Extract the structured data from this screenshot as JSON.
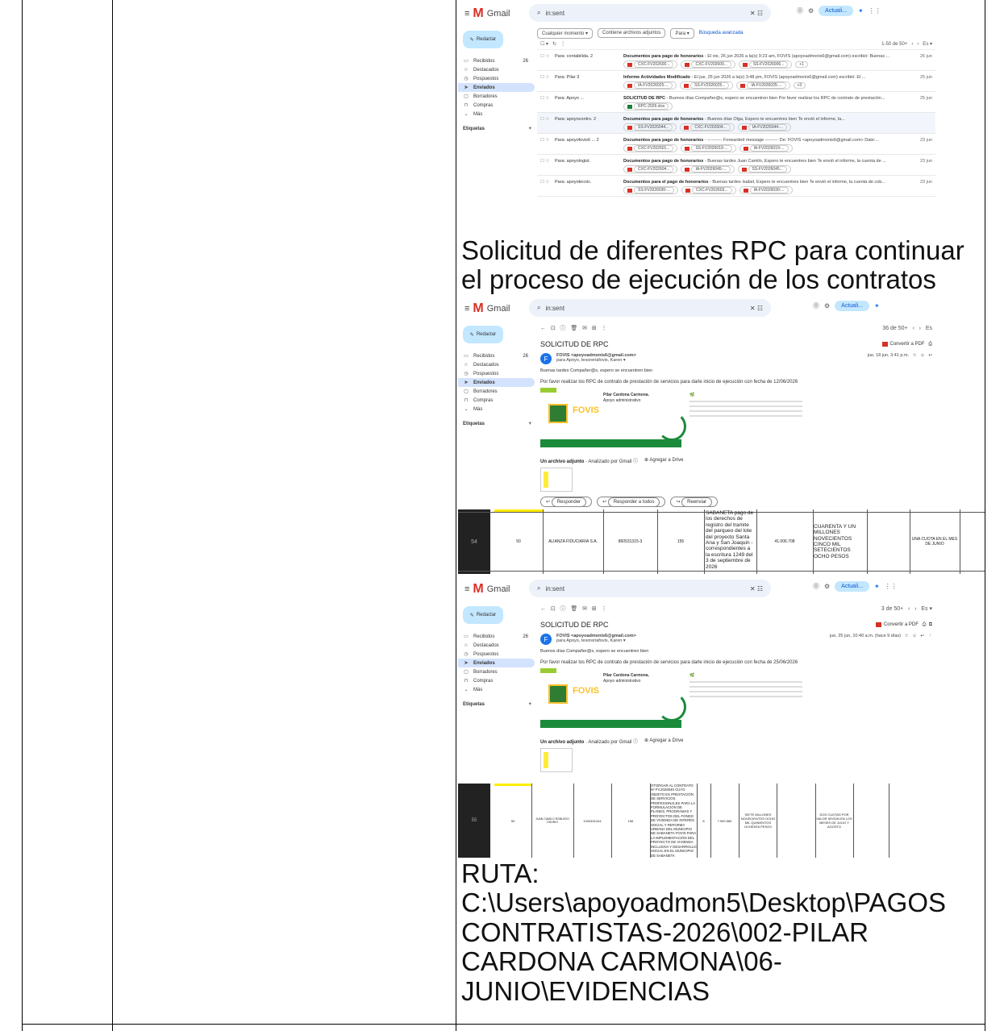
{
  "caption1": "Solicitud de diferentes RPC para continuar el proceso de ejecución de los contratos",
  "ruta": {
    "label": "RUTA:",
    "path": "C:\\Users\\apoyoadmon5\\Desktop\\PAGOS CONTRATISTAS-2026\\002-PILAR CARDONA CARMONA\\06-JUNIO\\EVIDENCIAS"
  },
  "gmail": {
    "app_name": "Gmail",
    "search_value": "in:sent",
    "status_pill": "Actuali...",
    "compose": "Redactar",
    "nav": [
      "Recibidos",
      "Destacados",
      "Pospuestos",
      "Enviados",
      "Borradores",
      "Compras",
      "Más"
    ],
    "inbox_count": "26",
    "labels": "Etiquetas",
    "filters": [
      "Cualquier momento ▾",
      "Contiene archivos adjuntos",
      "Para ▾"
    ],
    "advanced_search": "Búsqueda avanzada",
    "list_range": "1-50 de 50+"
  },
  "list": [
    {
      "to": "Para: contabilida. 2",
      "subject": "Documentos para pago de honorarios",
      "snippet": " - El vie, 26 jun 2026 a la(s) 9:23 am, FOVIS (apoyoadmonis6@gmail.com) escribió: Buenas ...",
      "date": "26 jun",
      "atts": [
        "CXC-FV202600...",
        "CXC-FV202600...",
        "SS-FV2026006..."
      ],
      "more": "+1",
      "kind": "pdf"
    },
    {
      "to": "Para: Pilar 3",
      "subject": "Informe Actividades Modificado",
      "snippet": " - El jue, 25 jun 2026 a la(s) 3:48 pm, FOVIS (apoyoadmonis6@gmail.com) escribió: El ...",
      "date": "25 jun",
      "atts": [
        "IA-FV2026025-...",
        "SS-FV2026025...",
        "IA-FV2026025-..."
      ],
      "more": "+3",
      "kind": "pdf"
    },
    {
      "to": "Para: Apoyo ...",
      "subject": "SOLICITUD DE RPC",
      "snippet": " - Buenos días Compañer@s, espero se encuentren bien Por favor realizar los RPC de contrato de prestación...",
      "date": "25 jun",
      "atts": [
        "RPC-2026.xlsx"
      ],
      "more": "",
      "kind": "xls"
    },
    {
      "to": "Para: apoyocontro. 2",
      "subject": "Documentos para pago de honorarios",
      "snippet": " - Buenos días Olga, Espero te encuentres bien Te envió el informe, la...",
      "date": "",
      "atts": [
        "SS-FV2026044...",
        "CXC-FV202604...",
        "IA-FV2026044-..."
      ],
      "more": "",
      "kind": "pdf"
    },
    {
      "to": "Para: apoyofovis6 ... 2",
      "subject": "Documentos para pago de honorarios",
      "snippet": " - ---------- Forwarded message --------- De: FOVIS <apoyoadmonis6@gmail.com> Date:...",
      "date": "23 jun",
      "atts": [
        "CXC-FV202601...",
        "SS-FV2026019-...",
        "IA-FV2026019-..."
      ],
      "more": "",
      "kind": "pdf"
    },
    {
      "to": "Para: apoyologist.",
      "subject": "Documentos para pago de honorarios",
      "snippet": " - Buenas tardes Juan Camilo, Espero te encuentres bien Te envió el informe, la cuenta de ...",
      "date": "23 jun",
      "atts": [
        "CXC-FV202604...",
        "IA-FV2026045-...",
        "SS-FV2026045..."
      ],
      "more": "",
      "kind": "pdf"
    },
    {
      "to": "Para: apoyotecnic.",
      "subject": "Documentos para el pago de honorarios",
      "snippet": " - Buenas tardes Isabel, Espero te encuentres bien Te envió el informe, la cuenta de cob...",
      "date": "23 jun",
      "atts": [
        "SS-FV2026030-...",
        "CXC-FV202603...",
        "IA-FV2026030-..."
      ],
      "more": "",
      "kind": "pdf"
    }
  ],
  "msg1": {
    "counter": "36 de 50+",
    "subject": "SOLICITUD DE RPC",
    "pdf_btn": "Convertir a PDF",
    "avatar": "F",
    "sender": "FOVIS <apoyoadmonis6@gmail.com>",
    "to": "para Apoyo, tesoreriafovis, Karen ▾",
    "date": "jue, 18 jun, 3:41 p.m.",
    "greeting": "Buenas tardes Compañer@s, espero se encuentren bien",
    "body": "Por favor realizar los RPC de contrato de prestación de servicios para darle inicio de ejecución con fecha de 12/06/2026",
    "sig_name": "Pilar Cardona Carmona.",
    "sig_role": "Apoyo administrativo",
    "attach_title": "Un archivo adjunto",
    "attach_scan": "· Analizado por Gmail ⓘ",
    "drive": "Agregar a Drive",
    "reply": "Responder",
    "reply_all": "Responder a todos",
    "forward": "Reenviar"
  },
  "row54": {
    "num": "54",
    "code": "50",
    "entity": "ALIANZA FIDUCIARIA S.A.",
    "nit": "860531315-3",
    "rubro": "156",
    "concept": "SABANETA pago de los derechos de registro del tramite del parqueo del lote del proyecto Santa Ana y San Joaquin - correspondientes a la escritura 1249 del 3 de septiembre de 2026",
    "value": "41.006.708",
    "letters": "CUARENTA Y UN MILLONES NOVECIENTOS CINCO MIL SETECIENTOS OCHO PESOS",
    "form": "UNA CUOTA EN EL MES DE JUNIO"
  },
  "msg2": {
    "counter": "3 de 50+",
    "subject": "SOLICITUD DE RPC",
    "pdf_btn": "Convertir a PDF",
    "avatar": "F",
    "sender": "FOVIS <apoyoadmonis6@gmail.com>",
    "to": "para Apoyo, tesoreriafovis, Karen ▾",
    "date": "jue, 25 jun, 10:40 a.m. (hace 9 días)",
    "greeting": "Buenos días Compañer@s, espero se encuentren bien",
    "body": "Por favor realizar los RPC de contrato de prestación de servicios para darle inicio de ejecución con fecha de 25/06/2026",
    "sig_name": "Pilar Cardona Carmona.",
    "sig_role": "Apoyo administrativo",
    "attach_title": "Un archivo adjunto",
    "attach_scan": "· Analizado por Gmail ⓘ",
    "drive": "Agregar a Drive"
  },
  "row55": {
    "num": "55",
    "code": "50",
    "entity": "JUAN CAMILO ROBLEDO OSORIO",
    "nit": "1020451244",
    "rubro": "156",
    "concept": "OTORGAR AL CONTRATO Nº FV.2026040 CUYO OBJETO ES PRESTACIÓN DE SERVICIOS PROFESIONALES PARA LA FORMULACIÓN DE PLANES, PROGRAMAS Y PROYECTOS DEL FONDO DE VIVIENDA DE INTERÉS SOCIAL Y REFORMA URBANA DEL MUNICIPIO DE SABANETA FOVIS PARA LA IMPLEMENTACIÓN DEL PROYECTO DE VIVIENDA INCLUSIVA Y DESARROLLO SOCIAL EN EL MUNICIPIO DE SABANETA",
    "term": "8",
    "value": "7.900.580",
    "letters": "SIETE MILLONES NOVECIENTOS OCHO MIL QUINIENTOS OCHENTA PESOS",
    "form": "DOS CUOTAS POR VALOR SEGÚN EN LOS MESES DE JULIO Y AGOSTO"
  }
}
